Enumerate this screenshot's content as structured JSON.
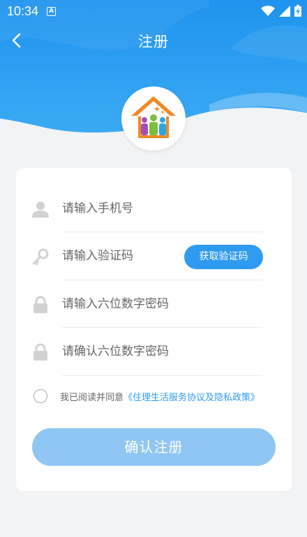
{
  "status_bar": {
    "time": "10:34",
    "notification_icon": "a-letter-icon"
  },
  "nav": {
    "title": "注册",
    "back_icon": "chevron-left-icon"
  },
  "form": {
    "phone_placeholder": "请输入手机号",
    "code_placeholder": "请输入验证码",
    "get_code_label": "获取验证码",
    "password_placeholder": "请输入六位数字密码",
    "confirm_password_placeholder": "请确认六位数字密码",
    "agreement_text": "我已阅读并同意",
    "agreement_link": "《住理生活服务协议及隐私政策》",
    "submit_label": "确认注册"
  },
  "colors": {
    "primary": "#2f9bf0",
    "submit_disabled": "#8fc6f4",
    "background": "#f2f3f5",
    "logo_roof": "#f08a24"
  }
}
